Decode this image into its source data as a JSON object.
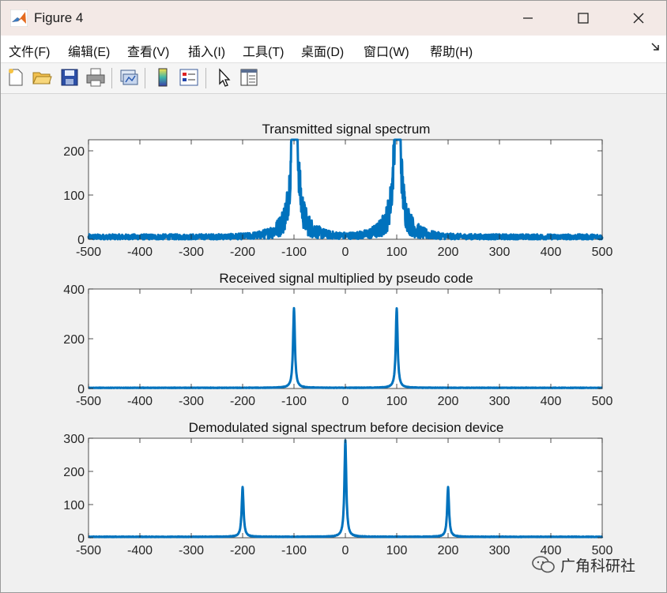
{
  "window": {
    "title": "Figure 4",
    "controls": {
      "minimize": "—",
      "maximize": "☐",
      "close": "✕"
    }
  },
  "menu": [
    {
      "label": "文件(F)"
    },
    {
      "label": "编辑(E)"
    },
    {
      "label": "查看(V)"
    },
    {
      "label": "插入(I)"
    },
    {
      "label": "工具(T)"
    },
    {
      "label": "桌面(D)"
    },
    {
      "label": "窗口(W)"
    },
    {
      "label": "帮助(H)"
    }
  ],
  "toolbar": [
    {
      "icon": "new-figure-icon"
    },
    {
      "icon": "open-file-icon"
    },
    {
      "icon": "save-icon"
    },
    {
      "icon": "print-icon"
    },
    {
      "icon": "link-plot-icon"
    },
    {
      "icon": "colorbar-icon"
    },
    {
      "icon": "legend-icon"
    },
    {
      "icon": "pointer-icon"
    },
    {
      "icon": "property-inspector-icon"
    }
  ],
  "colors": {
    "line": "#0072bd",
    "axes_bg": "#ffffff",
    "figure_bg": "#f0f0f0",
    "text": "#262626"
  },
  "watermark": {
    "text": "广角科研社",
    "icon": "wechat-icon"
  },
  "chart_data": [
    {
      "type": "line",
      "title": "Transmitted signal spectrum",
      "xlabel": "",
      "ylabel": "",
      "xlim": [
        -500,
        500
      ],
      "ylim": [
        0,
        225
      ],
      "xticks": [
        -500,
        -400,
        -300,
        -200,
        -100,
        0,
        100,
        200,
        300,
        400,
        500
      ],
      "yticks": [
        0,
        100,
        200
      ],
      "grid": false,
      "series": [
        {
          "style": "noisy-spectrum",
          "floor": 5,
          "noise": 6,
          "peaks": [
            {
              "x": -100,
              "y": 225,
              "width": 6
            },
            {
              "x": -97,
              "y": 195,
              "width": 4
            },
            {
              "x": 100,
              "y": 225,
              "width": 6
            },
            {
              "x": 103,
              "y": 195,
              "width": 4
            }
          ]
        }
      ]
    },
    {
      "type": "line",
      "title": "Received signal multiplied by pseudo code",
      "xlabel": "",
      "ylabel": "",
      "xlim": [
        -500,
        500
      ],
      "ylim": [
        0,
        400
      ],
      "xticks": [
        -500,
        -400,
        -300,
        -200,
        -100,
        0,
        100,
        200,
        300,
        400,
        500
      ],
      "yticks": [
        0,
        200,
        400
      ],
      "grid": false,
      "series": [
        {
          "style": "smooth-spectrum",
          "floor": 2,
          "noise": 1.5,
          "peaks": [
            {
              "x": -100,
              "y": 320,
              "width": 2.2
            },
            {
              "x": 100,
              "y": 320,
              "width": 2.2
            }
          ]
        }
      ]
    },
    {
      "type": "line",
      "title": "Demodulated signal spectrum before decision device",
      "xlabel": "",
      "ylabel": "",
      "xlim": [
        -500,
        500
      ],
      "ylim": [
        0,
        300
      ],
      "xticks": [
        -500,
        -400,
        -300,
        -200,
        -100,
        0,
        100,
        200,
        300,
        400,
        500
      ],
      "yticks": [
        0,
        100,
        200,
        300
      ],
      "grid": false,
      "series": [
        {
          "style": "smooth-spectrum",
          "floor": 2,
          "noise": 1.5,
          "peaks": [
            {
              "x": -200,
              "y": 150,
              "width": 2.2
            },
            {
              "x": 0,
              "y": 290,
              "width": 2.2
            },
            {
              "x": 200,
              "y": 150,
              "width": 2.2
            }
          ]
        }
      ]
    }
  ]
}
